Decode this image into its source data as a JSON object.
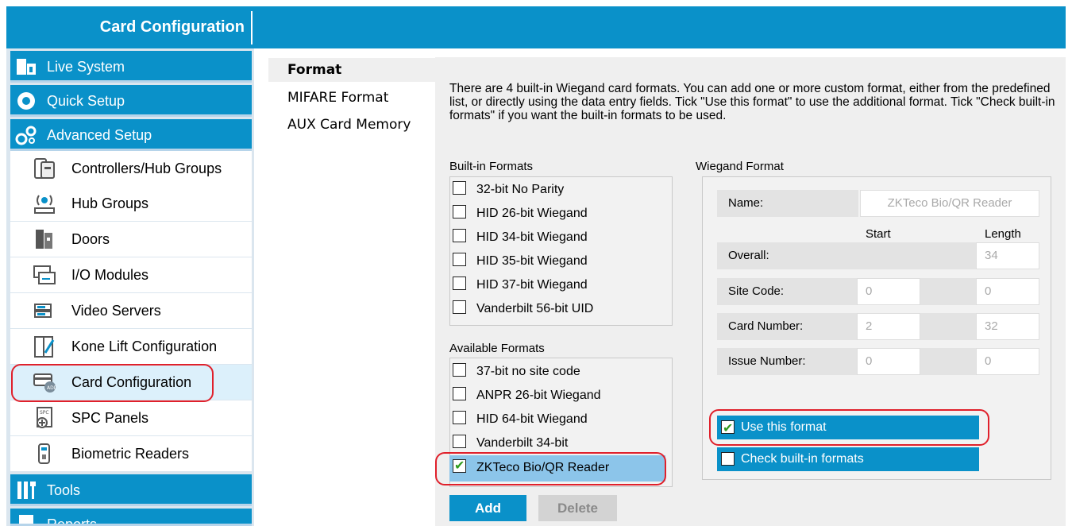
{
  "header": {
    "title": "Card Configuration"
  },
  "sidebar": {
    "main_items": [
      {
        "label": "Live System",
        "icon": "live-system-icon"
      },
      {
        "label": "Quick Setup",
        "icon": "gear-icon"
      },
      {
        "label": "Advanced Setup",
        "icon": "gears-icon"
      }
    ],
    "sub_items": [
      {
        "label": "Controllers/Hub Groups",
        "icon": "controller-icon"
      },
      {
        "label": "Hub Groups",
        "icon": "wireless-hub-icon"
      },
      {
        "label": "Doors",
        "icon": "door-icon"
      },
      {
        "label": "I/O Modules",
        "icon": "io-module-icon"
      },
      {
        "label": "Video Servers",
        "icon": "video-server-icon"
      },
      {
        "label": "Kone Lift Configuration",
        "icon": "lift-icon"
      },
      {
        "label": "Card Configuration",
        "icon": "card-icon",
        "active": true
      },
      {
        "label": "SPC Panels",
        "icon": "spc-panel-icon"
      },
      {
        "label": "Biometric Readers",
        "icon": "biometric-reader-icon"
      }
    ],
    "bottom_items": [
      {
        "label": "Tools",
        "icon": "tools-icon"
      },
      {
        "label": "Reports",
        "icon": "reports-icon"
      }
    ]
  },
  "tabs": [
    {
      "label": "Format",
      "active": true
    },
    {
      "label": "MIFARE Format"
    },
    {
      "label": "AUX Card Memory"
    }
  ],
  "intro": "There are 4 built-in Wiegand card formats. You can add one or more custom format, either from the predefined list, or directly using the data entry fields. Tick \"Use this format\" to use the additional format. Tick \"Check built-in formats\" if you want the built-in formats to be used.",
  "builtin": {
    "label": "Built-in Formats",
    "items": [
      "32-bit No Parity",
      "HID 26-bit Wiegand",
      "HID 34-bit Wiegand",
      "HID 35-bit Wiegand",
      "HID 37-bit Wiegand",
      "Vanderbilt 56-bit UID"
    ]
  },
  "available": {
    "label": "Available Formats",
    "items": [
      {
        "label": "37-bit no site code",
        "checked": false
      },
      {
        "label": "ANPR 26-bit Wiegand",
        "checked": false
      },
      {
        "label": "HID 64-bit Wiegand",
        "checked": false
      },
      {
        "label": "Vanderbilt 34-bit",
        "checked": false
      },
      {
        "label": "ZKTeco Bio/QR Reader",
        "checked": true
      }
    ]
  },
  "buttons": {
    "add": "Add",
    "delete": "Delete"
  },
  "wiegand": {
    "label": "Wiegand Format",
    "name_label": "Name:",
    "name_value": "ZKTeco Bio/QR Reader",
    "col_start": "Start",
    "col_length": "Length",
    "overall_label": "Overall:",
    "overall_length": "34",
    "site_label": "Site Code:",
    "site_start": "0",
    "site_length": "0",
    "card_label": "Card Number:",
    "card_start": "2",
    "card_length": "32",
    "issue_label": "Issue Number:",
    "issue_start": "0",
    "issue_length": "0",
    "use_format": "Use this format",
    "use_format_checked": true,
    "check_builtin": "Check built-in formats",
    "check_builtin_checked": false
  },
  "colors": {
    "accent": "#0a91c9",
    "annotation": "#e0202b",
    "check": "#2f9a1d"
  }
}
